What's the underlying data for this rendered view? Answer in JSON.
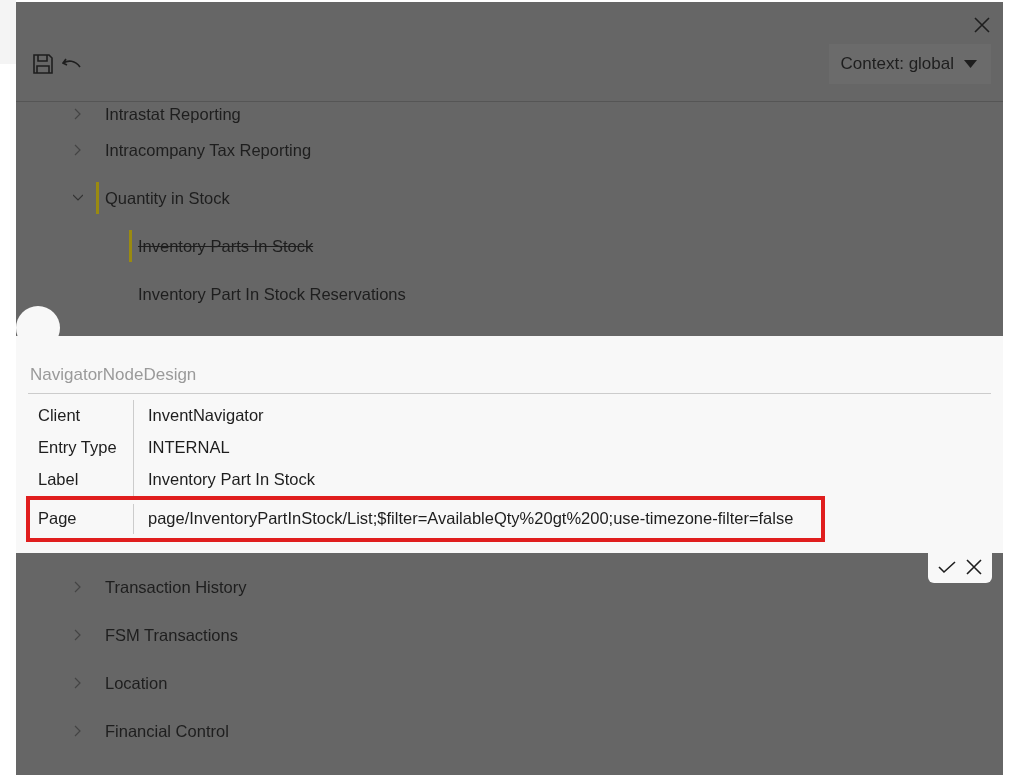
{
  "toolbar": {
    "context": "Context: global"
  },
  "tree": {
    "nodes_top": [
      {
        "label": "Intrastat Reporting",
        "expanded": false,
        "marked": false,
        "struck": false
      },
      {
        "label": "Intracompany Tax Reporting",
        "expanded": false,
        "marked": false,
        "struck": false
      },
      {
        "label": "Quantity in Stock",
        "expanded": true,
        "marked": true,
        "struck": false,
        "children": [
          {
            "label": "Inventory Parts In Stock",
            "marked": true,
            "struck": true
          },
          {
            "label": "Inventory Part In Stock Reservations",
            "marked": false,
            "struck": false
          }
        ]
      }
    ],
    "nodes_bottom": [
      {
        "label": "Transaction History",
        "expanded": false,
        "marked": false,
        "struck": false
      },
      {
        "label": "FSM Transactions",
        "expanded": false,
        "marked": false,
        "struck": false
      },
      {
        "label": "Location",
        "expanded": false,
        "marked": false,
        "struck": false
      },
      {
        "label": "Financial Control",
        "expanded": false,
        "marked": false,
        "struck": false
      }
    ]
  },
  "popover": {
    "title": "NavigatorNodeDesign",
    "fields": [
      {
        "label": "Client",
        "value": "InventNavigator",
        "highlighted": false
      },
      {
        "label": "Entry Type",
        "value": "INTERNAL",
        "highlighted": false
      },
      {
        "label": "Label",
        "value": "Inventory Part In Stock",
        "highlighted": false
      },
      {
        "label": "Page",
        "value": "page/InventoryPartInStock/List;$filter=AvailableQty%20gt%200;use-timezone-filter=false",
        "highlighted": true
      }
    ]
  }
}
